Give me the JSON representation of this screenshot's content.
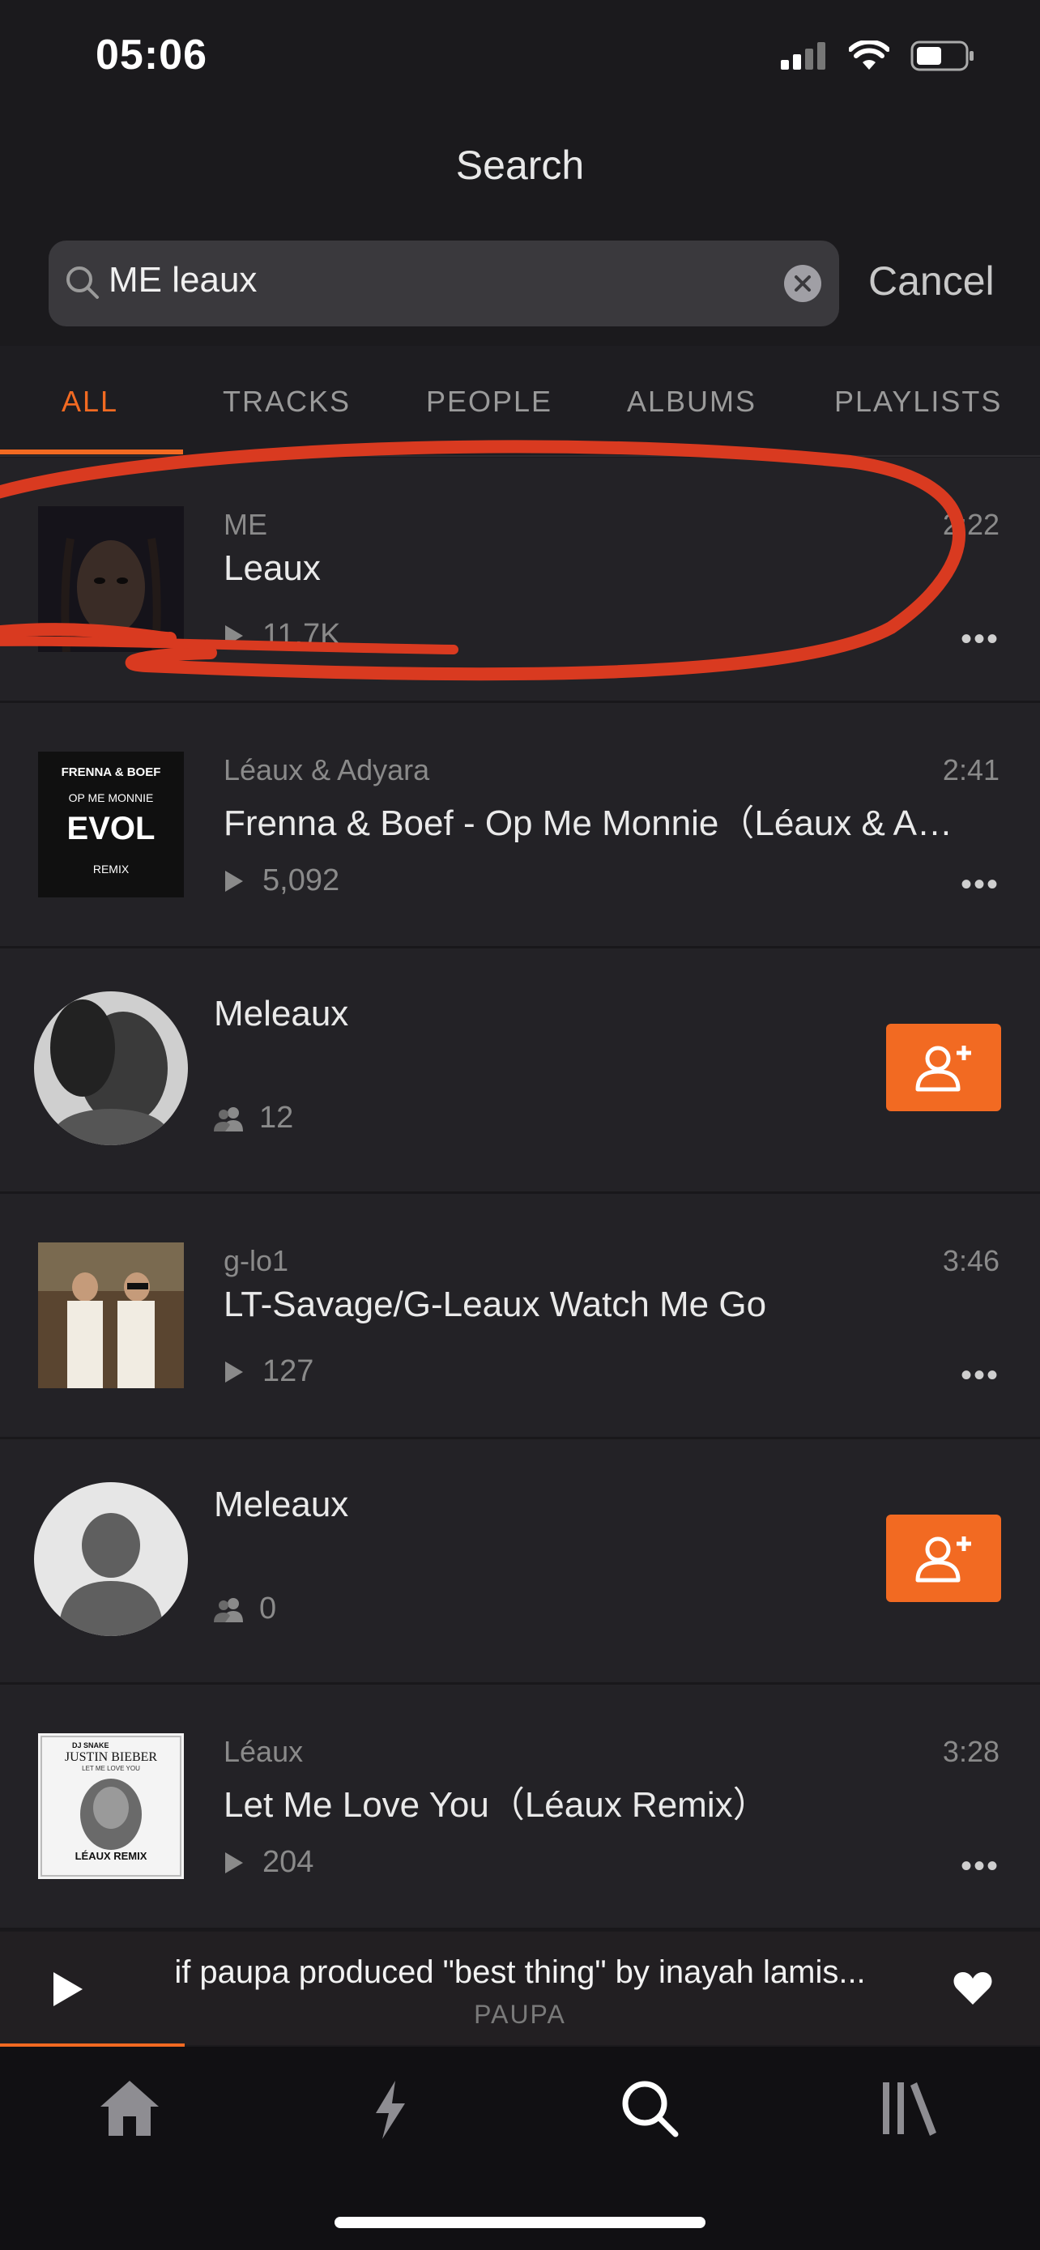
{
  "status_bar": {
    "time": "05:06"
  },
  "header": {
    "title": "Search"
  },
  "search": {
    "query": "ME leaux",
    "cancel_label": "Cancel"
  },
  "tabs": [
    {
      "label": "ALL",
      "active": true
    },
    {
      "label": "TRACKS"
    },
    {
      "label": "PEOPLE"
    },
    {
      "label": "ALBUMS"
    },
    {
      "label": "PLAYLISTS"
    }
  ],
  "results": [
    {
      "type": "track",
      "artist": "ME",
      "title": "Leaux",
      "plays": "11.7K",
      "duration": "2:22"
    },
    {
      "type": "track",
      "artist": "Léaux & Adyara",
      "title": "Frenna & Boef - Op Me Monnie（Léaux & Adyara Remix）",
      "plays": "5,092",
      "duration": "2:41",
      "artwork_text": [
        "FRENNA & BOEF",
        "OP ME MONNIE",
        "EVOL",
        "REMIX"
      ]
    },
    {
      "type": "user",
      "name": "Meleaux",
      "followers": "12"
    },
    {
      "type": "track",
      "artist": "g-lo1",
      "title": "LT-Savage/G-Leaux Watch Me Go",
      "plays": "127",
      "duration": "3:46"
    },
    {
      "type": "user",
      "name": "Meleaux",
      "followers": "0"
    },
    {
      "type": "track",
      "artist": "Léaux",
      "title": "Let Me Love You（Léaux Remix）",
      "plays": "204",
      "duration": "3:28",
      "artwork_text": [
        "DJ SNAKE",
        "JUSTIN BIEBER",
        "LET ME LOVE YOU",
        "LÉAUX REMIX"
      ]
    }
  ],
  "now_playing": {
    "title": "if paupa produced \"best thing\" by inayah lamis...",
    "artist": "PAUPA"
  },
  "bottom_nav": [
    {
      "icon": "home-icon"
    },
    {
      "icon": "stream-bolt-icon"
    },
    {
      "icon": "search-icon",
      "active": true
    },
    {
      "icon": "library-icon"
    }
  ],
  "colors": {
    "accent": "#f26a22",
    "background": "#1b1a1d",
    "row": "#232226",
    "annotation": "#d93a20"
  }
}
